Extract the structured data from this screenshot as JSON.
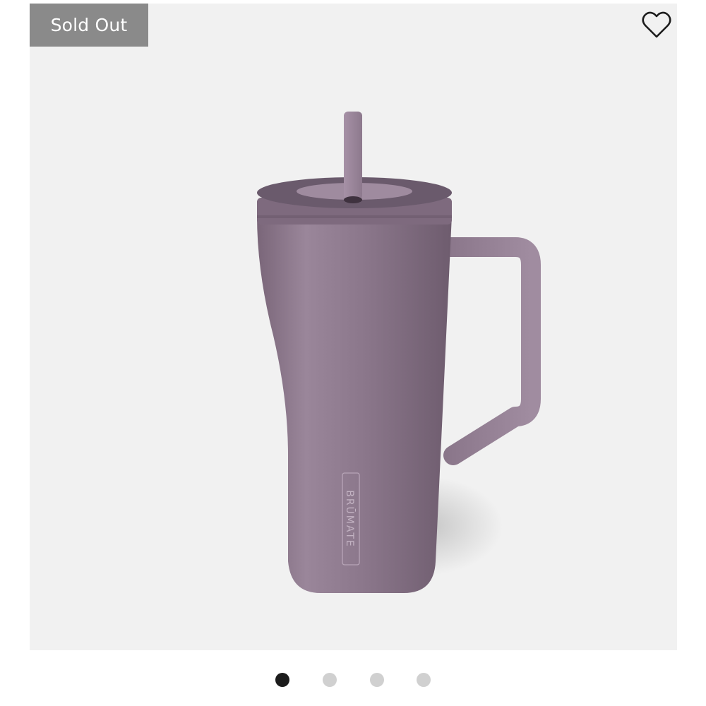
{
  "badge": {
    "label": "Sold Out"
  },
  "wishlist": {
    "icon": "heart-outline-icon"
  },
  "product": {
    "brand_mark": "BRŪMATE",
    "color": "#8e7a8e"
  },
  "carousel": {
    "count": 4,
    "active_index": 0,
    "active_color": "#1c1c1c",
    "inactive_color": "#d0d0d0"
  }
}
